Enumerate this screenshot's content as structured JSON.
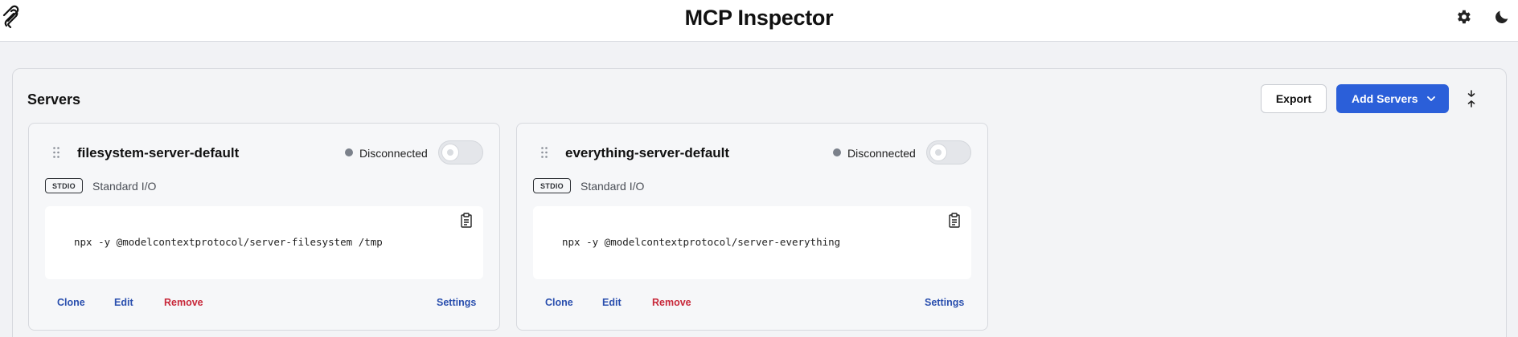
{
  "app": {
    "title": "MCP Inspector"
  },
  "toolbar": {
    "settings_icon": "gear-icon",
    "theme_icon": "moon-icon"
  },
  "servers_panel": {
    "title": "Servers",
    "export_label": "Export",
    "add_label": "Add Servers"
  },
  "servers": [
    {
      "name": "filesystem-server-default",
      "status": "Disconnected",
      "connected": false,
      "transport_badge": "STDIO",
      "transport_label": "Standard I/O",
      "command": "npx -y @modelcontextprotocol/server-filesystem /tmp",
      "actions": {
        "clone": "Clone",
        "edit": "Edit",
        "remove": "Remove",
        "settings": "Settings"
      }
    },
    {
      "name": "everything-server-default",
      "status": "Disconnected",
      "connected": false,
      "transport_badge": "STDIO",
      "transport_label": "Standard I/O",
      "command": "npx -y @modelcontextprotocol/server-everything",
      "actions": {
        "clone": "Clone",
        "edit": "Edit",
        "remove": "Remove",
        "settings": "Settings"
      }
    }
  ],
  "colors": {
    "accent": "#2b5fd9",
    "link": "#2a4fae",
    "danger": "#c8283a",
    "status_disconnected": "#7b818b"
  }
}
